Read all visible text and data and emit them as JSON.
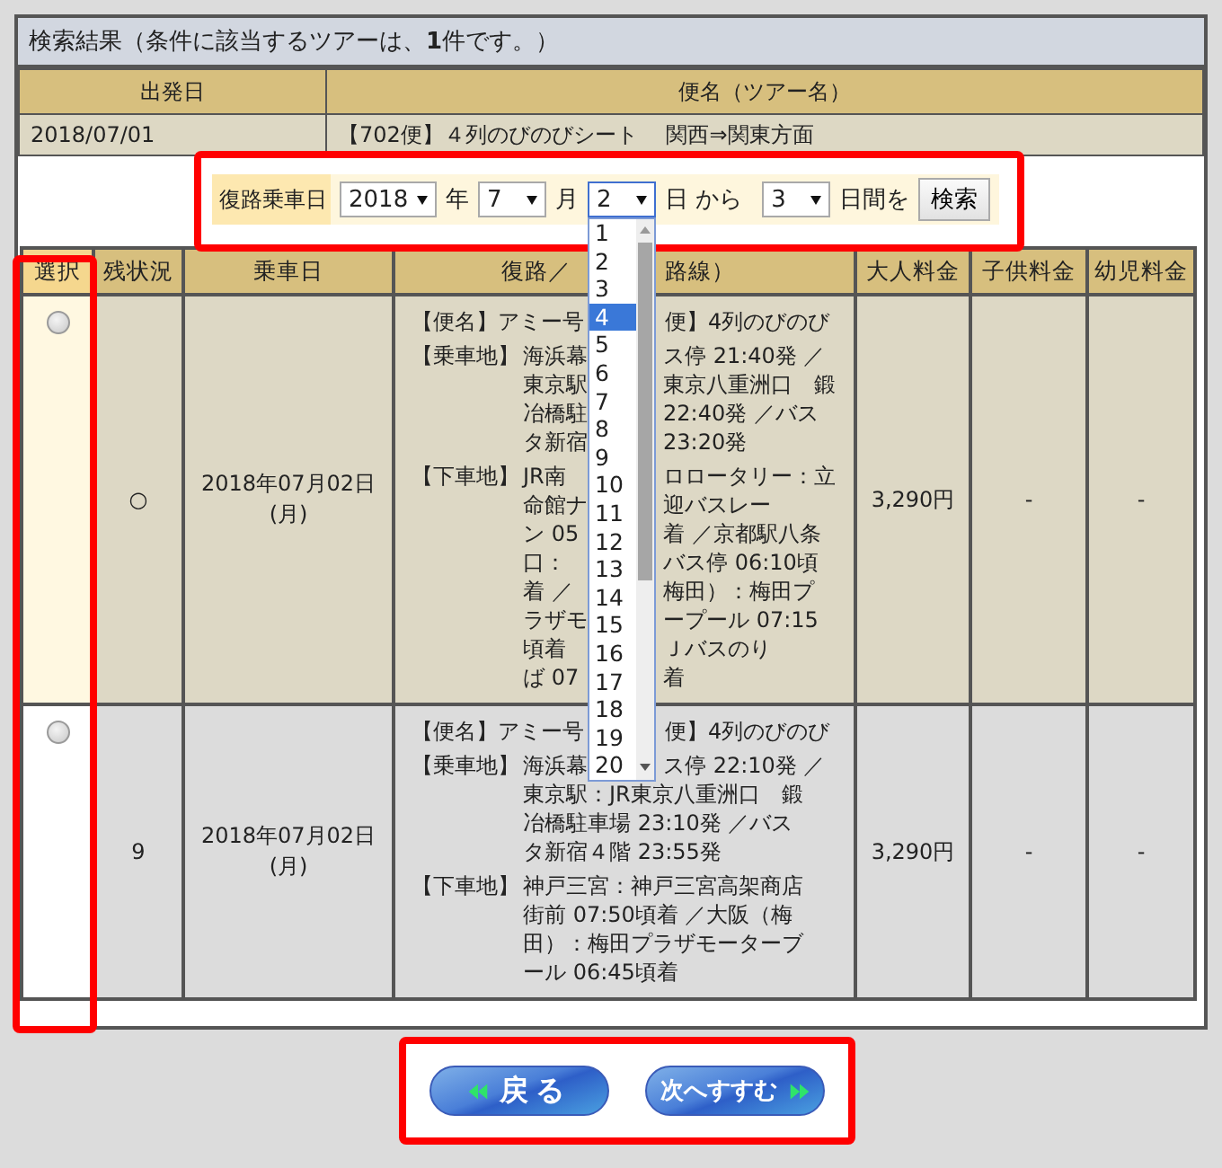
{
  "result_header": "検索結果（条件に該当するツアーは、**1**件です。）",
  "summary": {
    "columns": [
      "出発日",
      "便名（ツアー名）"
    ],
    "row": [
      "2018/07/01",
      "【702便】４列のびのびシート　 関西⇒関東方面"
    ]
  },
  "return_form": {
    "label": "復路乗車日",
    "year": "2018",
    "year_unit": "年",
    "month": "7",
    "month_unit": "月",
    "day": "2",
    "day_unit": "日 から",
    "span": "3",
    "span_unit": "日間を",
    "button": "検索",
    "day_options": [
      {
        "label": "1",
        "selected": false
      },
      {
        "label": "2",
        "selected": false
      },
      {
        "label": "3",
        "selected": false
      },
      {
        "label": "4",
        "selected": true
      },
      {
        "label": "5",
        "selected": false
      },
      {
        "label": "6",
        "selected": false
      },
      {
        "label": "7",
        "selected": false
      },
      {
        "label": "8",
        "selected": false
      },
      {
        "label": "9",
        "selected": false
      },
      {
        "label": "10",
        "selected": false
      },
      {
        "label": "11",
        "selected": false
      },
      {
        "label": "12",
        "selected": false
      },
      {
        "label": "13",
        "selected": false
      },
      {
        "label": "14",
        "selected": false
      },
      {
        "label": "15",
        "selected": false
      },
      {
        "label": "16",
        "selected": false
      },
      {
        "label": "17",
        "selected": false
      },
      {
        "label": "18",
        "selected": false
      },
      {
        "label": "19",
        "selected": false
      },
      {
        "label": "20",
        "selected": false
      }
    ]
  },
  "table": {
    "columns": [
      "選択",
      "残状況",
      "乗車日",
      "復路／",
      "路線）",
      "大人料金",
      "子供料金",
      "幼児料金"
    ],
    "rows": [
      {
        "selected": false,
        "highlighted": true,
        "status": "○",
        "date": "2018年07月02日",
        "weekday": "(月)",
        "adult": "3,290円",
        "child": "-",
        "infant": "-",
        "title": {
          "left": "【便名】アミー号",
          "right": "便】4列のびのび"
        },
        "stops": [
          {
            "label": "【乗車地】",
            "lines": [
              {
                "left": "海浜幕",
                "right": "ス停 21:40発 ／"
              },
              {
                "left": "東京駅",
                "right": "東京八重洲口　鍛"
              },
              {
                "left": "冶橋駐",
                "right": "22:40発 ／バス"
              },
              {
                "left": "タ新宿",
                "right": "23:20発"
              }
            ]
          },
          {
            "label": "【下車地】",
            "lines": [
              {
                "left": "JR南",
                "right": "ロロータリー：立"
              },
              {
                "left": "命館ナ",
                "right": "迎バスレー"
              },
              {
                "left": "ン 05",
                "right": "着 ／京都駅八条"
              },
              {
                "left": "口：",
                "right": "バス停 06:10頃"
              },
              {
                "left": "着 ／",
                "right": "梅田）：梅田プ"
              },
              {
                "left": "ラザモ",
                "right": "ープール 07:15"
              },
              {
                "left": "頃着",
                "right": "Ｊバスのり"
              },
              {
                "left": "ば 07",
                "right": "着"
              }
            ]
          }
        ]
      },
      {
        "selected": false,
        "highlighted": false,
        "status": "9",
        "date": "2018年07月02日",
        "weekday": "(月)",
        "adult": "3,290円",
        "child": "-",
        "infant": "-",
        "title": {
          "left": "【便名】アミー号",
          "right": "便】4列のびのび"
        },
        "stops": [
          {
            "label": "【乗車地】",
            "lines": [
              {
                "left": "海浜幕",
                "right": "ス停 22:10発 ／"
              },
              {
                "text": "東京駅：JR東京八重洲口　鍛"
              },
              {
                "text": "冶橋駐車場 23:10発 ／バス"
              },
              {
                "text": "タ新宿４階 23:55発"
              }
            ]
          },
          {
            "label": "【下車地】",
            "lines": [
              {
                "text": "神戸三宮：神戸三宮高架商店"
              },
              {
                "text": "街前 07:50頃着 ／大阪（梅"
              },
              {
                "text": "田）：梅田プラザモーターブ"
              },
              {
                "text": "ール 06:45頃着"
              }
            ]
          }
        ]
      }
    ]
  },
  "buttons": [
    {
      "label": "戻る",
      "kind": "back"
    },
    {
      "label": "次へすすむ",
      "kind": "next"
    }
  ]
}
